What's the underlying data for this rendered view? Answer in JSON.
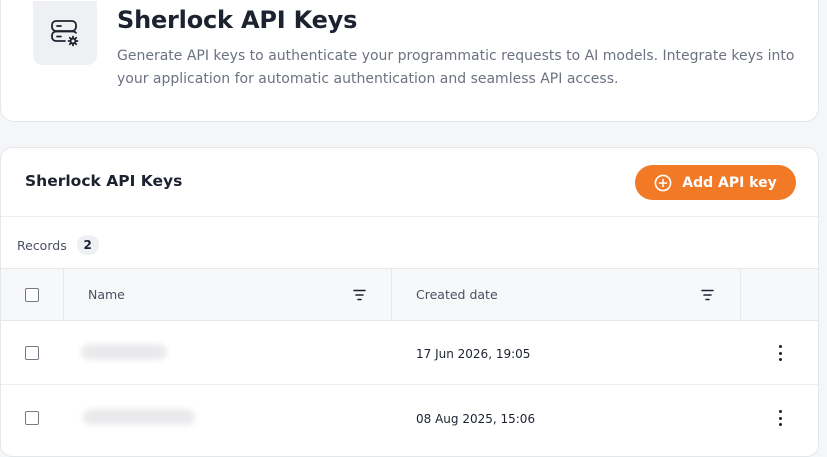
{
  "header": {
    "title": "Sherlock API Keys",
    "description": "Generate API keys to authenticate your programmatic requests to AI models. Integrate keys into your application for automatic authentication and seamless API access.",
    "icon": "server-settings-icon"
  },
  "table_card": {
    "title": "Sherlock API Keys",
    "add_button_label": "Add API key",
    "add_button_icon": "plus-circle-icon",
    "records_label": "Records",
    "records_count": "2",
    "columns": [
      {
        "label": "Name",
        "icon": "filter-icon"
      },
      {
        "label": "Created date",
        "icon": "filter-icon"
      }
    ],
    "rows": [
      {
        "created": "17 Jun 2026, 19:05"
      },
      {
        "created": "08 Aug 2025, 15:06"
      }
    ]
  },
  "colors": {
    "accent": "#f27a27",
    "text_primary": "#1d2230",
    "text_secondary": "#6b7280",
    "border": "#e4e6ea"
  }
}
